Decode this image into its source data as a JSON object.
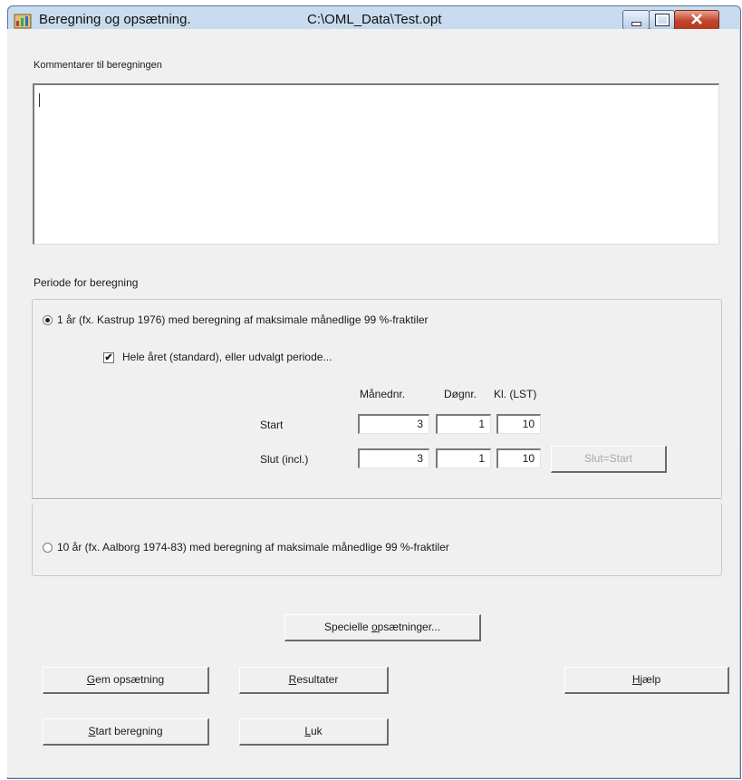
{
  "window": {
    "title": "Beregning og opsætning.",
    "path": "C:\\OML_Data\\Test.opt"
  },
  "comments": {
    "label": "Kommentarer til beregningen",
    "value": ""
  },
  "period": {
    "label": "Periode for beregning",
    "option1": {
      "label": "1 år (fx. Kastrup 1976) med beregning af maksimale månedlige 99 %-fraktiler",
      "selected": true
    },
    "whole_year": {
      "label": "Hele året (standard), eller udvalgt periode...",
      "checked": true
    },
    "columns": [
      "Månednr.",
      "Døgnr.",
      "Kl. (LST)"
    ],
    "start": {
      "label": "Start",
      "month": "3",
      "day": "1",
      "hour": "10"
    },
    "end": {
      "label": "Slut (incl.)",
      "month": "3",
      "day": "1",
      "hour": "10"
    },
    "slut_start_button": "Slut=Start",
    "option2": {
      "label": "10 år (fx. Aalborg 1974-83) med beregning af maksimale månedlige 99 %-fraktiler",
      "selected": false
    }
  },
  "buttons": {
    "special": {
      "pre": "Specielle ",
      "accel": "o",
      "post": "psætninger..."
    },
    "save": {
      "pre": "",
      "accel": "G",
      "post": "em opsætning"
    },
    "results": {
      "pre": "",
      "accel": "R",
      "post": "esultater"
    },
    "help": {
      "pre": "",
      "accel": "H",
      "post": "jælp"
    },
    "start": {
      "pre": "",
      "accel": "S",
      "post": "tart beregning"
    },
    "close": {
      "pre": "",
      "accel": "L",
      "post": "uk"
    }
  }
}
